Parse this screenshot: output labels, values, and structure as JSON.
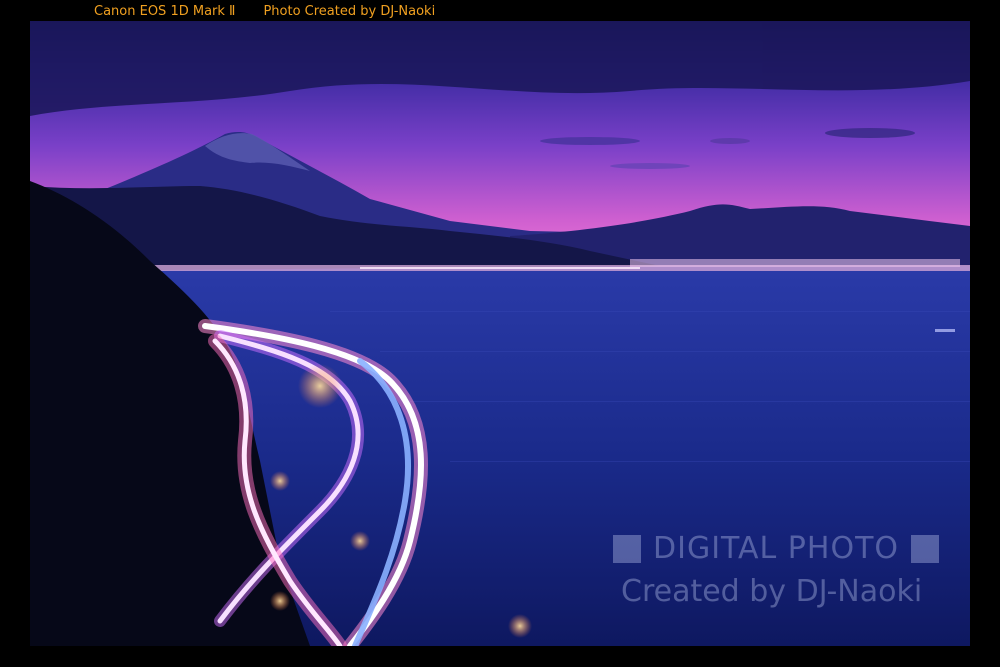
{
  "caption": {
    "camera": "Canon EOS 1D Mark Ⅱ",
    "credit": "Photo Created by DJ-Naoki"
  },
  "watermark": {
    "line1": "DIGITAL PHOTO",
    "line2": "Created by DJ-Naoki"
  },
  "colors": {
    "caption": "#f0a020",
    "sky_top": "#1c1870",
    "sky_horizon": "#e060d0",
    "sea": "#1a2a8a"
  }
}
